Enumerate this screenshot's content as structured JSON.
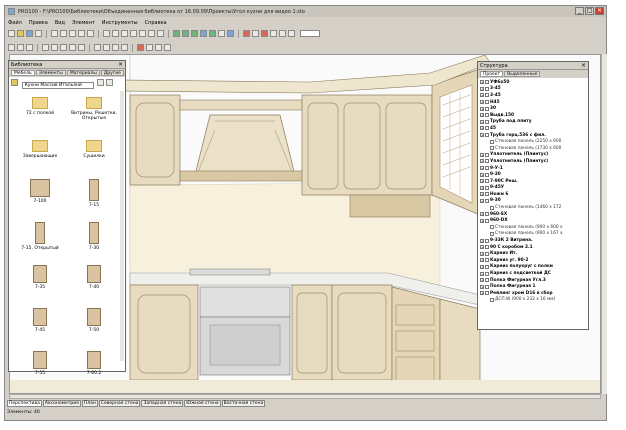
{
  "window": {
    "title": "PRO100 - F:\\PRO100\\Библиотеки\\Объединенная библиотека от 16.09.09\\Проекты\\Угол кухни для видео 1.sto"
  },
  "menu": [
    "Файл",
    "Правка",
    "Вид",
    "Элемент",
    "Инструменты",
    "Справка"
  ],
  "library": {
    "title": "Библиотека",
    "tabs": [
      "Мебель",
      "Элементы",
      "Материалы",
      "Другие"
    ],
    "select": "Кухни Массив Итальянй",
    "items": [
      {
        "label": "72 с полкой",
        "kind": "folder"
      },
      {
        "label": "Витрины, Решетки, Открытые",
        "kind": "folder"
      },
      {
        "label": "Завершающие",
        "kind": "folder"
      },
      {
        "label": "Сушилки",
        "kind": "folder"
      },
      {
        "label": "7-100",
        "kind": "cab-w"
      },
      {
        "label": "7-15",
        "kind": "cab-t"
      },
      {
        "label": "7-15, Открытый",
        "kind": "cab-t"
      },
      {
        "label": "7-30",
        "kind": "cab-t"
      },
      {
        "label": "7-35",
        "kind": "cab"
      },
      {
        "label": "7-40",
        "kind": "cab"
      },
      {
        "label": "7-45",
        "kind": "cab"
      },
      {
        "label": "7-50",
        "kind": "cab"
      },
      {
        "label": "7-55",
        "kind": "cab"
      },
      {
        "label": "7-60.2",
        "kind": "cab"
      }
    ]
  },
  "structure": {
    "title": "Структура",
    "tabs": [
      "Проект",
      "Выделенные"
    ],
    "rows": [
      {
        "t": "УФ6х50",
        "b": true
      },
      {
        "t": "3-45",
        "b": true
      },
      {
        "t": "3-45",
        "b": true
      },
      {
        "t": "Н45",
        "b": true
      },
      {
        "t": "30",
        "b": true
      },
      {
        "t": "Выдв.150",
        "b": true
      },
      {
        "t": "Труба под плиту",
        "b": true
      },
      {
        "t": "45",
        "b": true
      },
      {
        "t": "Труба горц.536 с фил.",
        "b": true
      },
      {
        "t": "Стеновая панель  (2250 х 600",
        "sub": true
      },
      {
        "t": "Стеновая панель  (1730 х 600",
        "sub": true
      },
      {
        "t": "Уплотнитель (Плинтус)",
        "b": true
      },
      {
        "t": "Уплотнитель (Плинтус)",
        "b": true
      },
      {
        "t": "9-У-1",
        "b": true
      },
      {
        "t": "9-30",
        "b": true
      },
      {
        "t": "7-90С Реш.",
        "b": true
      },
      {
        "t": "9-45У",
        "b": true
      },
      {
        "t": "Ножи 6",
        "b": true
      },
      {
        "t": "9-30",
        "b": true
      },
      {
        "t": "Стеновая панель  (1460 х 172",
        "sub": true
      },
      {
        "t": "960-SX",
        "b": true
      },
      {
        "t": "960-DX",
        "b": true
      },
      {
        "t": "Стеновая панель  (900 х 600 х",
        "sub": true
      },
      {
        "t": "Стеновая панель  (900 х 167 х",
        "sub": true
      },
      {
        "t": "9-33К 2 Витрина.",
        "b": true
      },
      {
        "t": "90 С коробом 2.1",
        "b": true
      },
      {
        "t": "Карниз Ит.",
        "b": true
      },
      {
        "t": "Карниз уг. 90-2",
        "b": true
      },
      {
        "t": "Карниз полукруг с полки",
        "b": true
      },
      {
        "t": "Карниз с подсветкой ДС",
        "b": true
      },
      {
        "t": "Полка Фигурная Угл.3",
        "b": true
      },
      {
        "t": "Полка Фигурная 1",
        "b": true
      },
      {
        "t": "Рейлинг хром D16 в сбор",
        "b": true
      },
      {
        "t": "ДСП.W  (900 х 232 х 16 мм)",
        "sub": true
      }
    ]
  },
  "view_tabs": [
    "Перспектива",
    "Аксонометрия",
    "План",
    "Северная стена",
    "Западная стена",
    "Южная стена",
    "Восточная стена"
  ],
  "status": "Элементы: 40",
  "colors": {
    "wood": "#e8dcc0",
    "wood_dark": "#c9b48f",
    "counter": "#efefec",
    "oven": "#d8d8d8",
    "backsplash": "#f6f0dc"
  }
}
